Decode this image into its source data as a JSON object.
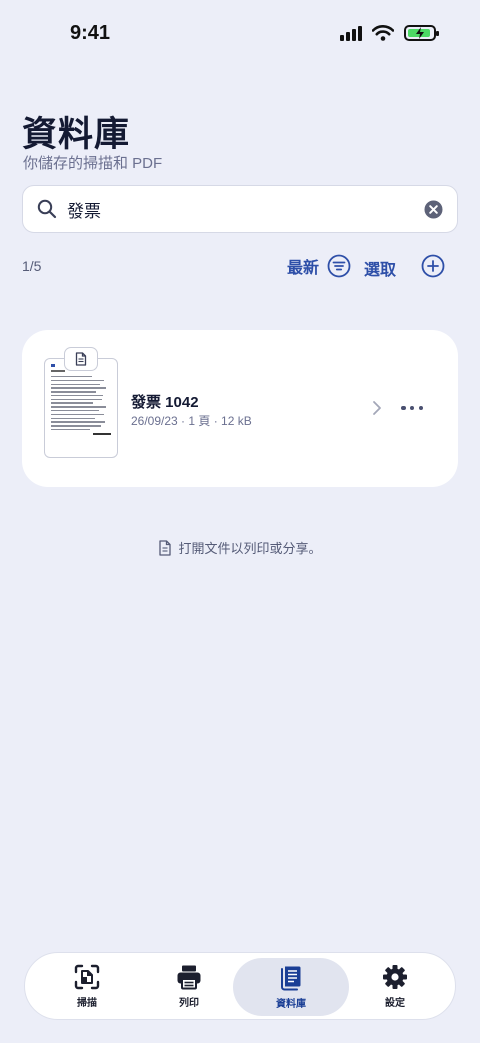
{
  "status_bar": {
    "time": "9:41"
  },
  "header": {
    "title": "資料庫",
    "subtitle": "你儲存的掃描和 PDF"
  },
  "search": {
    "value": "發票"
  },
  "toolbar": {
    "result_count": "1/5",
    "sort_label": "最新",
    "select_label": "選取"
  },
  "documents": [
    {
      "title": "發票 1042",
      "meta": "26/09/23 · 1 頁 · 12 kB"
    }
  ],
  "hint": {
    "text": "打開文件以列印或分享。"
  },
  "tabs": [
    {
      "label": "掃描",
      "icon": "scan-icon",
      "active": false
    },
    {
      "label": "列印",
      "icon": "printer-icon",
      "active": false
    },
    {
      "label": "資料庫",
      "icon": "library-icon",
      "active": true
    },
    {
      "label": "設定",
      "icon": "gear-icon",
      "active": false
    }
  ],
  "colors": {
    "accent": "#2e4fa8",
    "background": "#eceef8",
    "battery": "#4cd964"
  }
}
